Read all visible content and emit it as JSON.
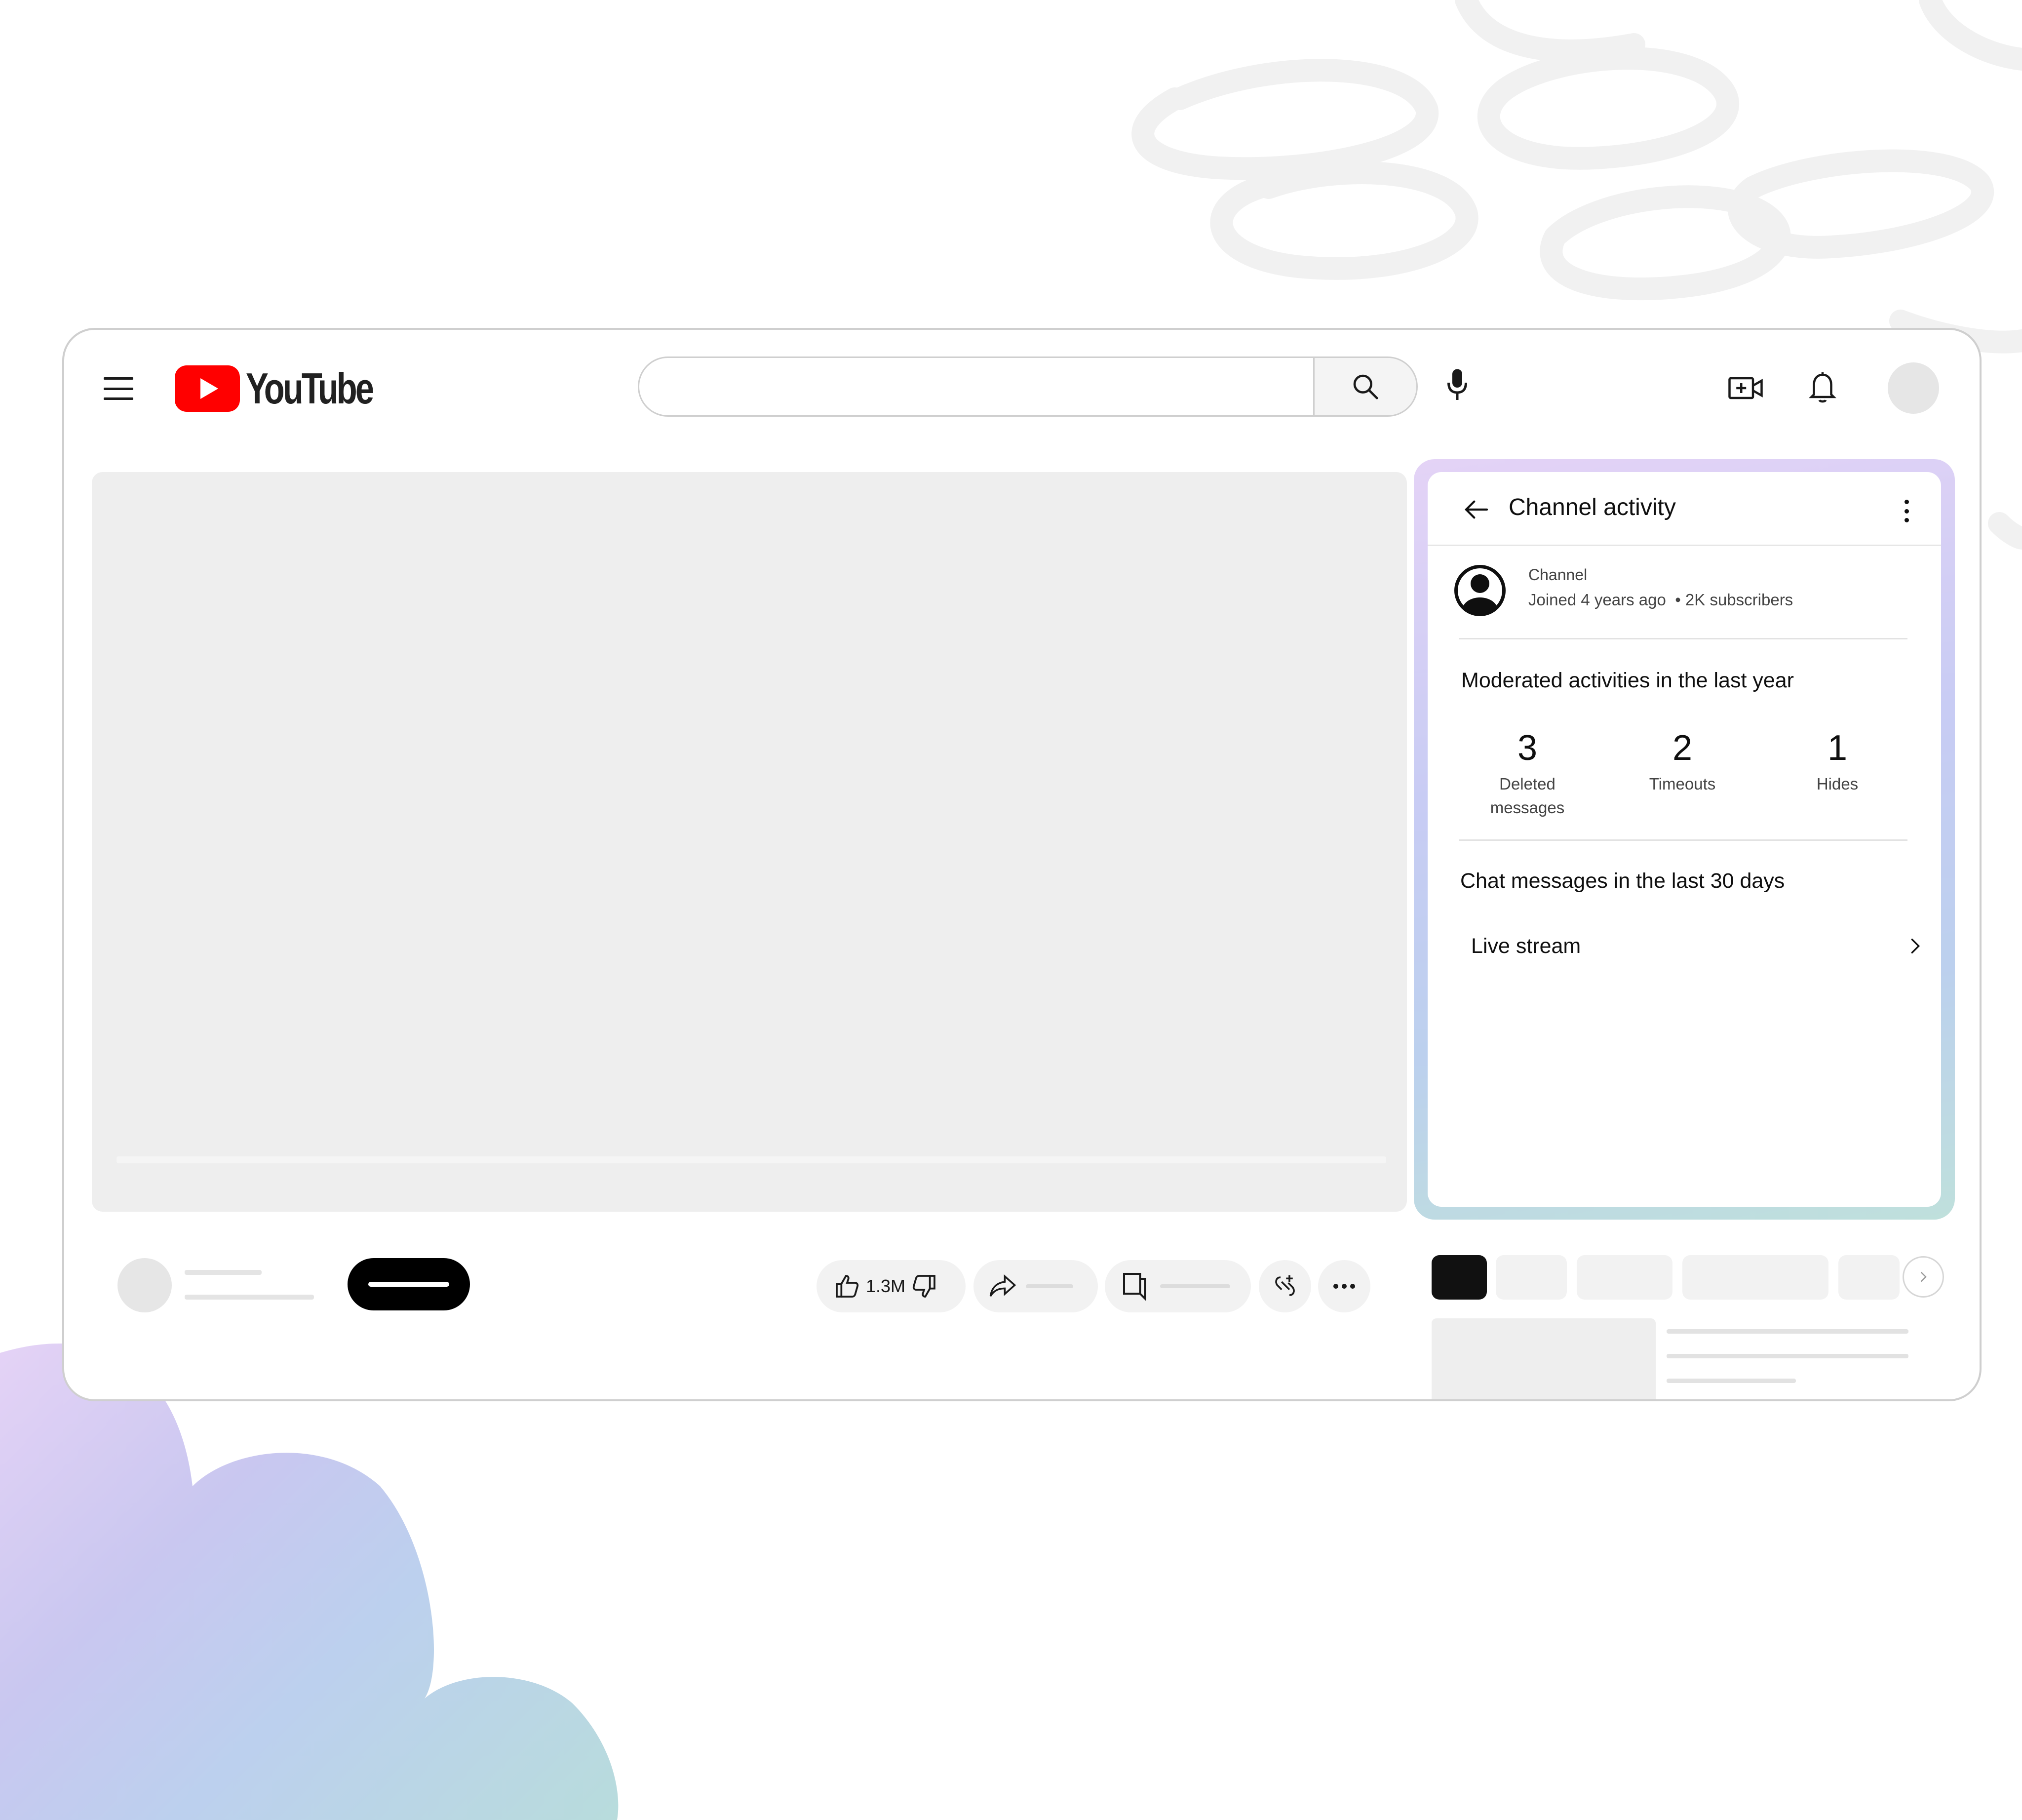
{
  "header": {
    "logo_text": "YouTube",
    "search": {
      "value": "",
      "placeholder": ""
    },
    "icons": [
      "menu-icon",
      "youtube-logo-icon",
      "search-icon",
      "mic-icon",
      "create-video-icon",
      "bell-icon"
    ]
  },
  "actions": {
    "like_count": "1.3M",
    "icons": [
      "thumbs-up-icon",
      "thumbs-down-icon",
      "share-icon",
      "save-playlist-icon",
      "clip-icon",
      "more-horizontal-icon"
    ]
  },
  "panel": {
    "title": "Channel activity",
    "channel": {
      "label": "Channel",
      "joined": "Joined 4 years ago",
      "subscribers": "• 2K subscribers"
    },
    "moderated": {
      "title": "Moderated activities in the last year",
      "stats": [
        {
          "value": "3",
          "label": "Deleted messages"
        },
        {
          "value": "2",
          "label": "Timeouts"
        },
        {
          "value": "1",
          "label": "Hides"
        }
      ]
    },
    "chat": {
      "title": "Chat messages in the last 30 days",
      "live_stream_label": "Live stream"
    }
  },
  "colors": {
    "brand_red": "#FF0000",
    "text_primary": "#0F0F0F",
    "skeleton": "#E4E4E4",
    "panel_gradient": [
      "#E4D3F6",
      "#C8CCF4",
      "#BCD0EE",
      "#BFE0DC"
    ]
  }
}
